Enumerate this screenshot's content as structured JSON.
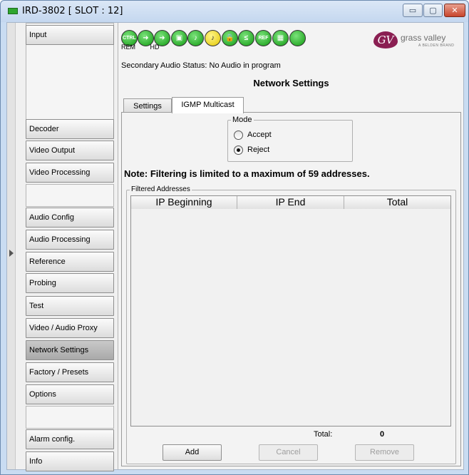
{
  "window": {
    "title": "IRD-3802 [ SLOT : 12]",
    "controls": {
      "minimize": "▭",
      "maximize": "▢",
      "close": "✕"
    }
  },
  "nav": {
    "items": [
      {
        "label": "Input"
      },
      {
        "label": "Decoder"
      },
      {
        "label": "Video Output"
      },
      {
        "label": "Video Processing"
      },
      {
        "label": "Audio Config"
      },
      {
        "label": "Audio Processing"
      },
      {
        "label": "Reference"
      },
      {
        "label": "Probing"
      },
      {
        "label": "Test"
      },
      {
        "label": "Video / Audio Proxy"
      },
      {
        "label": "Network Settings",
        "active": true
      },
      {
        "label": "Factory / Presets"
      },
      {
        "label": "Options"
      },
      {
        "label": "Alarm config."
      },
      {
        "label": "Info"
      }
    ]
  },
  "status_icons": {
    "icons": [
      {
        "name": "ctrl-icon",
        "text": "CTRL",
        "color": "green"
      },
      {
        "name": "input-arrow-icon",
        "text": "➜",
        "color": "green"
      },
      {
        "name": "output-arrow-icon",
        "text": "➜",
        "color": "green"
      },
      {
        "name": "video-icon",
        "text": "▣",
        "color": "green"
      },
      {
        "name": "audio-icon",
        "text": "♪",
        "color": "green"
      },
      {
        "name": "audio-warning-icon",
        "text": "♪",
        "color": "yellow"
      },
      {
        "name": "audio-lock-icon",
        "text": "🔒",
        "color": "green"
      },
      {
        "name": "compare-icon",
        "text": "≤",
        "color": "green"
      },
      {
        "name": "reference-icon",
        "text": "REF",
        "color": "green"
      },
      {
        "name": "monitor-icon",
        "text": "▦",
        "color": "green"
      },
      {
        "name": "status-led-icon",
        "text": "",
        "color": "green"
      }
    ],
    "rem_label": "REM",
    "hd_label": "HD"
  },
  "brand": {
    "logo_mark": "GV",
    "name": "grass valley",
    "subline": "A BELDEN BRAND"
  },
  "status_text": "Secondary Audio Status: No Audio in program",
  "panel_title": "Network Settings",
  "tabs": [
    {
      "label": "Settings"
    },
    {
      "label": "IGMP Multicast",
      "active": true
    }
  ],
  "mode": {
    "legend": "Mode",
    "options": [
      {
        "label": "Accept",
        "selected": false
      },
      {
        "label": "Reject",
        "selected": true
      }
    ]
  },
  "note": "Note: Filtering is limited to a maximum of 59 addresses.",
  "filtered": {
    "legend": "Filtered Addresses",
    "columns": [
      "IP Beginning",
      "IP End",
      "Total"
    ],
    "rows": [],
    "total_label": "Total:",
    "total_value": "0"
  },
  "buttons": {
    "add": "Add",
    "cancel": "Cancel",
    "remove": "Remove"
  }
}
